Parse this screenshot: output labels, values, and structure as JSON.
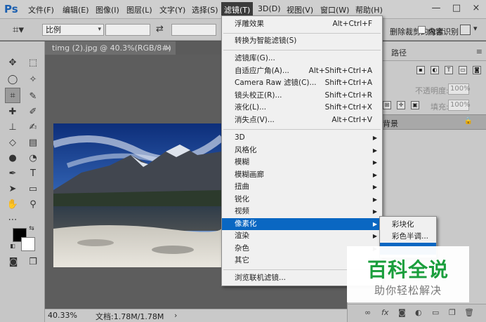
{
  "menubar": {
    "logo": "Ps",
    "items": [
      "文件(F)",
      "编辑(E)",
      "图像(I)",
      "图层(L)",
      "文字(Y)",
      "选择(S)",
      "滤镜(T)",
      "3D(D)",
      "视图(V)",
      "窗口(W)",
      "帮助(H)"
    ],
    "window_controls": [
      "—",
      "□",
      "×"
    ]
  },
  "options": {
    "ratio": "比例",
    "delete_pixels": "删除裁剪的像素",
    "content_aware": "内容识别"
  },
  "document": {
    "tab_title": "timg (2).jpg @ 40.3%(RGB/8#) *",
    "zoom": "40.33%",
    "doc_info": "文档:1.78M/1.78M"
  },
  "panel": {
    "tab_paths": "路径",
    "opacity_label": "不透明度:",
    "opacity_value": "100%",
    "fill_label": "填充:",
    "fill_value": "100%",
    "layer_name": "背景"
  },
  "filter_menu": {
    "items": [
      {
        "label": "浮雕效果",
        "shortcut": "Alt+Ctrl+F"
      },
      {
        "label": "转换为智能滤镜(S)",
        "shortcut": ""
      },
      {
        "label": "滤镜库(G)...",
        "shortcut": ""
      },
      {
        "label": "自适应广角(A)...",
        "shortcut": "Alt+Shift+Ctrl+A"
      },
      {
        "label": "Camera Raw 滤镜(C)...",
        "shortcut": "Shift+Ctrl+A"
      },
      {
        "label": "镜头校正(R)...",
        "shortcut": "Shift+Ctrl+R"
      },
      {
        "label": "液化(L)...",
        "shortcut": "Shift+Ctrl+X"
      },
      {
        "label": "消失点(V)...",
        "shortcut": "Alt+Ctrl+V"
      },
      {
        "label": "3D",
        "shortcut": ""
      },
      {
        "label": "风格化",
        "shortcut": ""
      },
      {
        "label": "模糊",
        "shortcut": ""
      },
      {
        "label": "模糊画廊",
        "shortcut": ""
      },
      {
        "label": "扭曲",
        "shortcut": ""
      },
      {
        "label": "锐化",
        "shortcut": ""
      },
      {
        "label": "视频",
        "shortcut": ""
      },
      {
        "label": "像素化",
        "shortcut": ""
      },
      {
        "label": "渲染",
        "shortcut": ""
      },
      {
        "label": "杂色",
        "shortcut": ""
      },
      {
        "label": "其它",
        "shortcut": ""
      },
      {
        "label": "浏览联机滤镜...",
        "shortcut": ""
      }
    ]
  },
  "submenu": {
    "items": [
      "彩块化",
      "彩色半调..."
    ]
  },
  "watermark": {
    "title": "百科全说",
    "subtitle": "助你轻松解决"
  }
}
